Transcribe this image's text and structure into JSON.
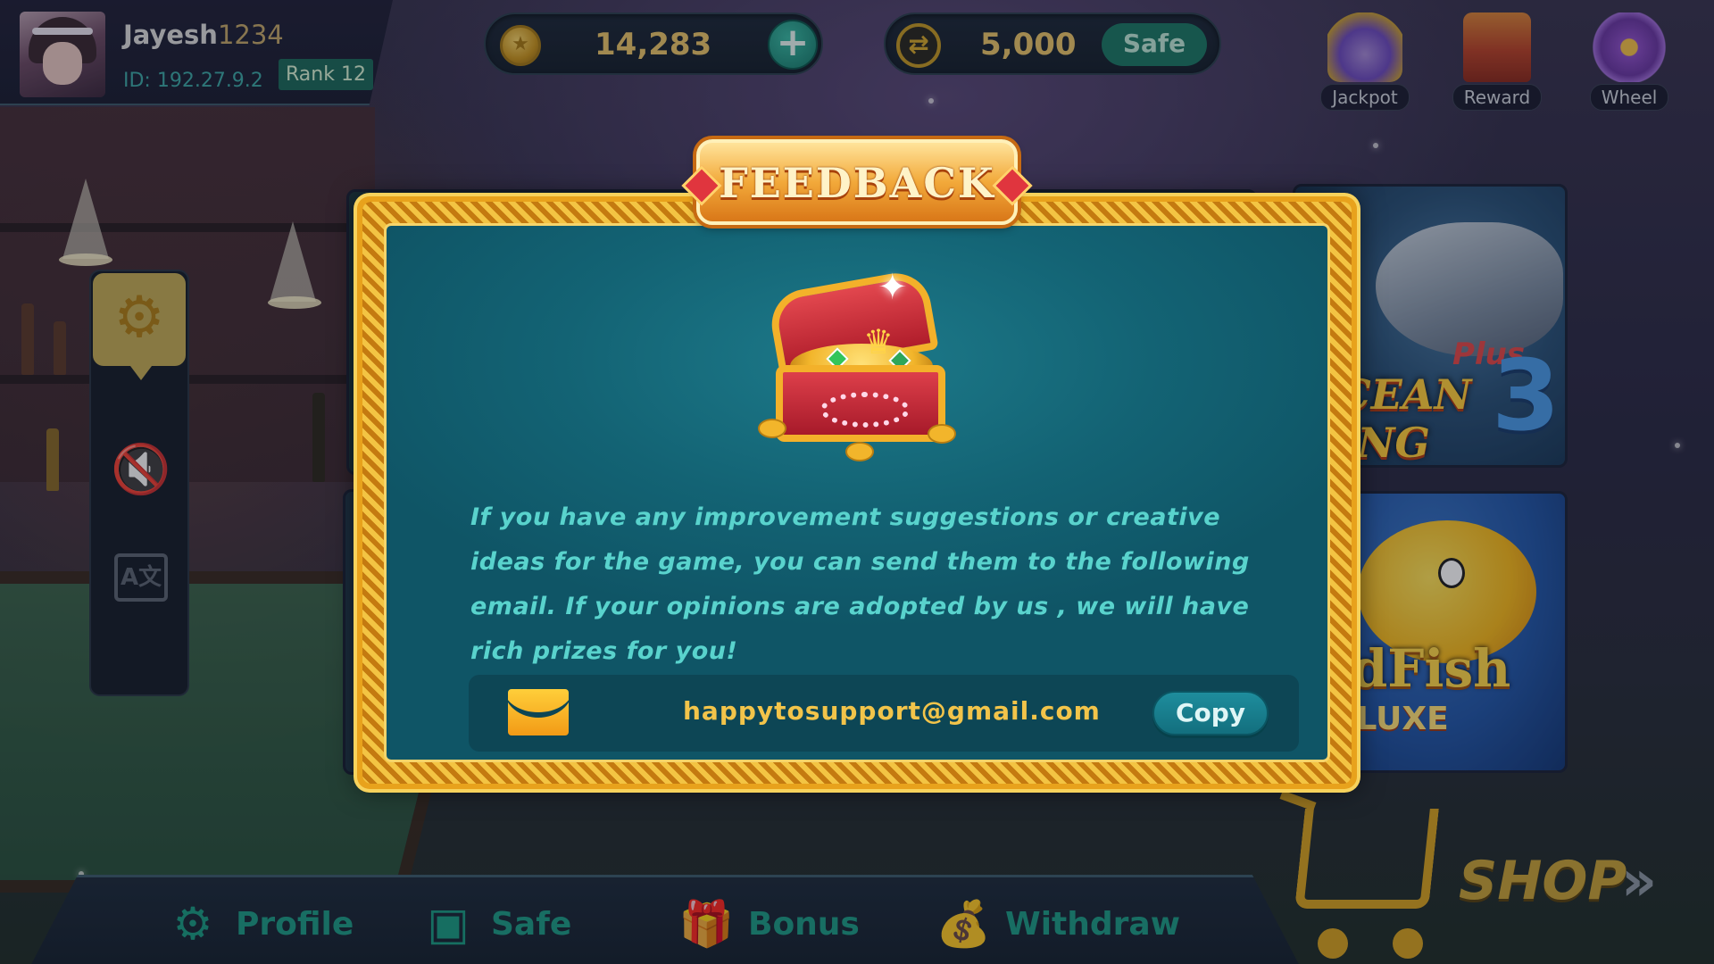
{
  "profile": {
    "username_name": "Jayesh",
    "username_number": "1234",
    "id_text": "ID: 192.27.9.2",
    "rank_text": "Rank 12"
  },
  "currency": {
    "coins": "14,283",
    "safe_balance": "5,000",
    "safe_label": "Safe",
    "plus_symbol": "+"
  },
  "top_icons": [
    {
      "label": "Jackpot",
      "icon": "jackpot-icon"
    },
    {
      "label": "Reward",
      "icon": "treasure-chest-icon"
    },
    {
      "label": "Wheel",
      "icon": "wheel-icon"
    }
  ],
  "side_panel": {
    "items": [
      {
        "icon": "gear-icon",
        "active": true
      },
      {
        "icon": "sound-off-icon",
        "active": false
      },
      {
        "icon": "language-icon",
        "active": false
      }
    ],
    "language_glyph": "A文"
  },
  "game_cards": [
    {
      "title": "OCEAN KING",
      "badge": "Plus",
      "number": "3"
    },
    {
      "title": "oldFish",
      "subtitle": "DELUXE"
    }
  ],
  "modal": {
    "title": "FEEDBACK",
    "message": "If you have any improvement suggestions or creative ideas for the game, you can send them to the following email. If your opinions are adopted by us , we will have rich prizes for you!",
    "email": "happytosupport@gmail.com",
    "copy_label": "Copy"
  },
  "bottom_nav": [
    {
      "label": "Profile",
      "icon": "profile-gear-icon"
    },
    {
      "label": "Safe",
      "icon": "safe-icon"
    },
    {
      "label": "Bonus",
      "icon": "gift-icon"
    },
    {
      "label": "Withdraw",
      "icon": "money-bag-icon"
    }
  ],
  "shop": {
    "label": "SHOP",
    "arrows": "»"
  },
  "colors": {
    "teal_accent": "#1f9c86",
    "gold_accent": "#e9c46a",
    "modal_bg": "#136374",
    "frame_gold": "#e8a21c"
  }
}
